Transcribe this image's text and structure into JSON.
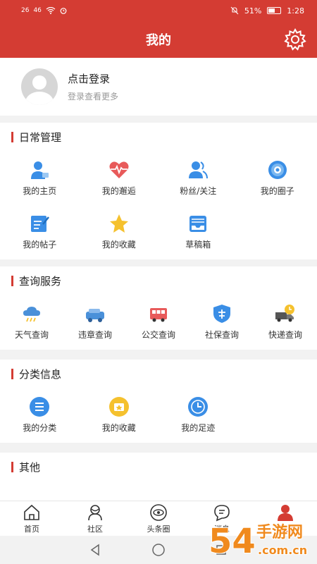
{
  "status": {
    "signal1": "26",
    "signal2": "46",
    "battery_pct": "51%",
    "time": "1:28"
  },
  "header": {
    "title": "我的"
  },
  "profile": {
    "login": "点击登录",
    "subtitle": "登录查看更多"
  },
  "daily": {
    "title": "日常管理",
    "items": [
      {
        "label": "我的主页",
        "icon": "person-home-icon"
      },
      {
        "label": "我的邂逅",
        "icon": "heartbeat-icon"
      },
      {
        "label": "粉丝/关注",
        "icon": "fans-icon"
      },
      {
        "label": "我的圈子",
        "icon": "circle-target-icon"
      },
      {
        "label": "我的帖子",
        "icon": "post-edit-icon"
      },
      {
        "label": "我的收藏",
        "icon": "star-icon"
      },
      {
        "label": "草稿箱",
        "icon": "drafts-tray-icon"
      }
    ]
  },
  "query": {
    "title": "查询服务",
    "items": [
      {
        "label": "天气查询",
        "icon": "weather-icon"
      },
      {
        "label": "违章查询",
        "icon": "car-violation-icon"
      },
      {
        "label": "公交查询",
        "icon": "bus-icon"
      },
      {
        "label": "社保查询",
        "icon": "social-security-icon"
      },
      {
        "label": "快递查询",
        "icon": "delivery-truck-icon"
      }
    ]
  },
  "category": {
    "title": "分类信息",
    "items": [
      {
        "label": "我的分类",
        "icon": "list-category-icon"
      },
      {
        "label": "我的收藏",
        "icon": "favorite-box-icon"
      },
      {
        "label": "我的足迹",
        "icon": "clock-footprint-icon"
      }
    ]
  },
  "other": {
    "title": "其他"
  },
  "nav": {
    "items": [
      {
        "label": "首页",
        "icon": "home-icon"
      },
      {
        "label": "社区",
        "icon": "community-icon"
      },
      {
        "label": "头条圈",
        "icon": "headline-circle-icon"
      },
      {
        "label": "消息",
        "icon": "message-icon"
      },
      {
        "label": "我的",
        "icon": "profile-icon"
      }
    ]
  },
  "watermark": {
    "text1": "54",
    "text2": "手游网",
    "text3": ".com.cn"
  },
  "colors": {
    "accent": "#d43c33",
    "blue": "#3a8ee6",
    "yellow": "#f5c12e"
  }
}
